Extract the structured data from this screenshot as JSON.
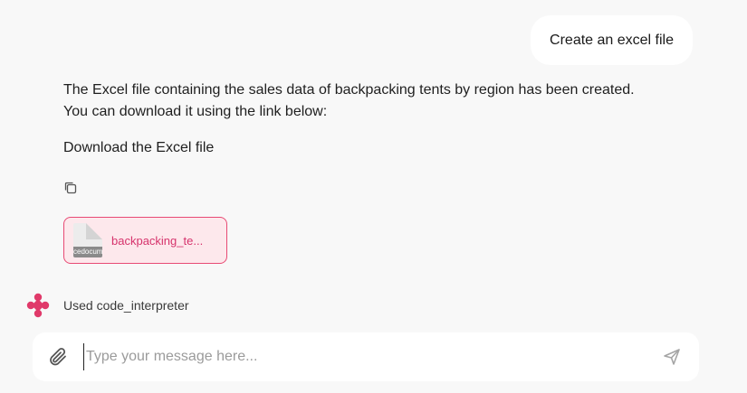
{
  "user_message": {
    "text": "Create an excel file"
  },
  "assistant_message": {
    "line1": "The Excel file containing the sales data of backpacking tents by region has been created.",
    "line2": "You can download it using the link below:",
    "link_text": "Download the Excel file"
  },
  "copy": {
    "icon": "copy-icon"
  },
  "file_chip": {
    "name": "backpacking_te...",
    "thumb_label": "cedocum",
    "icon": "file-icon"
  },
  "tool_use": {
    "text": "Used code_interpreter",
    "icon": "brand-logo"
  },
  "composer": {
    "placeholder": "Type your message here...",
    "attach_icon": "paperclip-icon",
    "send_icon": "send-icon"
  },
  "colors": {
    "background": "#f8f8f8",
    "accent": "#e84a74",
    "chip_bg": "#fde8ec",
    "chip_text": "#d6336c"
  }
}
